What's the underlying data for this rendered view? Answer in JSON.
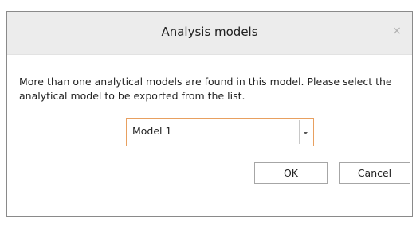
{
  "dialog": {
    "title": "Analysis models",
    "close_glyph": "×",
    "message": "More than one analytical models are found in this model. Please select the analytical model to be exported from the list.",
    "model_select": {
      "selected": "Model 1"
    },
    "buttons": {
      "ok_label": "OK",
      "cancel_label": "Cancel"
    }
  },
  "colors": {
    "titlebar_bg": "#ececec",
    "focus_border": "#e8a060",
    "border": "#8a8a8a"
  }
}
